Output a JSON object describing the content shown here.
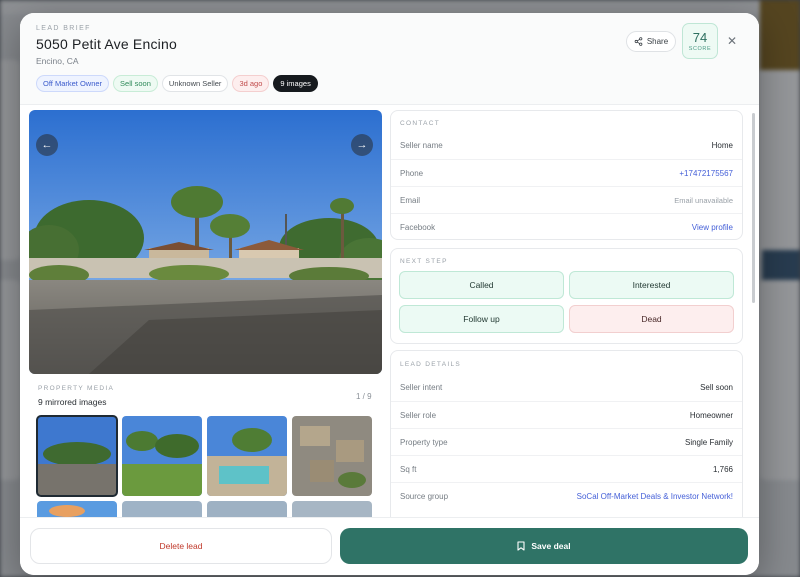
{
  "header": {
    "eyebrow": "LEAD BRIEF",
    "title": "5050 Petit Ave Encino",
    "subtitle": "Encino, CA",
    "tags": [
      "Off Market Owner",
      "Sell soon",
      "Unknown Seller",
      "3d ago",
      "9 images"
    ],
    "share_label": "Share",
    "score_value": "74",
    "score_label": "SCORE"
  },
  "media": {
    "eyebrow": "PROPERTY MEDIA",
    "count_label": "9 mirrored images",
    "page_indicator": "1 / 9"
  },
  "contact": {
    "eyebrow": "CONTACT",
    "rows": [
      {
        "key": "Seller name",
        "value": "Home"
      },
      {
        "key": "Phone",
        "value": "+17472175567"
      },
      {
        "key": "Email",
        "value": "Email unavailable"
      },
      {
        "key": "Facebook",
        "value": "View profile"
      }
    ]
  },
  "next_step": {
    "eyebrow": "NEXT STEP",
    "buttons": [
      "Called",
      "Interested",
      "Follow up",
      "Dead"
    ]
  },
  "lead_details": {
    "eyebrow": "LEAD DETAILS",
    "rows": [
      {
        "key": "Seller intent",
        "value": "Sell soon"
      },
      {
        "key": "Seller role",
        "value": "Homeowner"
      },
      {
        "key": "Property type",
        "value": "Single Family"
      },
      {
        "key": "Sq ft",
        "value": "1,766"
      },
      {
        "key": "Source group",
        "value": "SoCal Off-Market Deals & Investor Network!"
      }
    ]
  },
  "footer": {
    "delete_label": "Delete lead",
    "save_label": "Save deal"
  },
  "colors": {
    "accent": "#2f7366",
    "link": "#4560d8",
    "danger": "#c0392b"
  }
}
